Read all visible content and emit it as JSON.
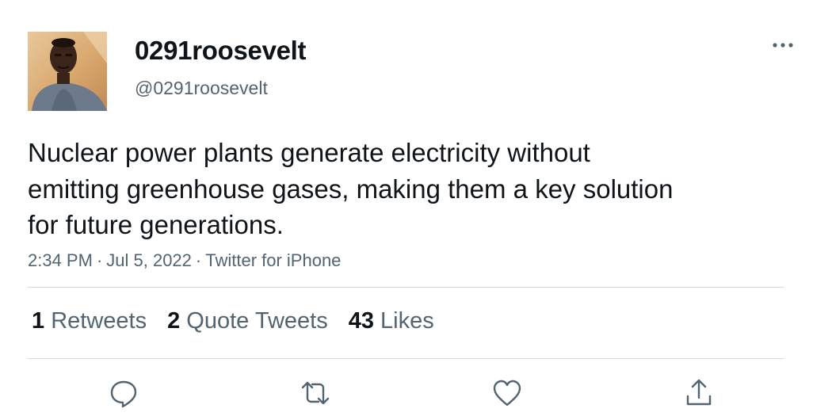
{
  "author": {
    "display_name": "0291roosevelt",
    "handle": "@0291roosevelt",
    "avatar_icon": "user-avatar-photo"
  },
  "tweet": {
    "text_lines": [
      "Nuclear power plants generate electricity without",
      "emitting greenhouse gases, making them a key solution",
      "for future generations."
    ],
    "time": "2:34 PM",
    "date": "Jul 5, 2022",
    "source": "Twitter for iPhone",
    "separator": "·"
  },
  "stats": {
    "retweets": {
      "count": "1",
      "label": "Retweets"
    },
    "quote_tweets": {
      "count": "2",
      "label": "Quote Tweets"
    },
    "likes": {
      "count": "43",
      "label": "Likes"
    }
  },
  "actions": [
    "reply-icon",
    "retweet-icon",
    "like-icon",
    "share-icon"
  ],
  "colors": {
    "text_primary": "#0f1419",
    "text_secondary": "#536471",
    "divider": "#cfd9de"
  }
}
